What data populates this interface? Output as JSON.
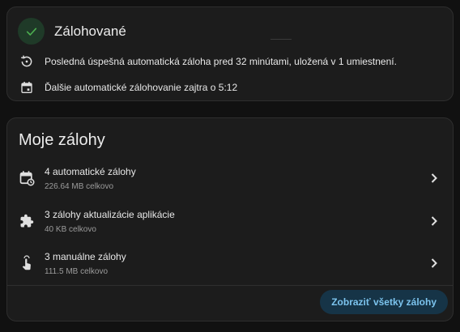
{
  "status": {
    "title": "Zálohované",
    "last_backup": "Posledná úspešná automatická záloha pred 32 minútami, uložená v 1 umiestnení.",
    "next_backup": "Ďalšie automatické zálohovanie zajtra o 5:12",
    "icons": {
      "status": "check-icon",
      "last": "history-icon",
      "next": "calendar-icon"
    },
    "colors": {
      "ok": "#4caf50",
      "ok_bg": "#1f3a28"
    }
  },
  "backups": {
    "title": "Moje zálohy",
    "items": [
      {
        "label": "4 automatické zálohy",
        "size": "226.64 MB celkovo",
        "icon": "calendar-sync-icon"
      },
      {
        "label": "3 zálohy aktualizácie aplikácie",
        "size": "40 KB celkovo",
        "icon": "puzzle-icon"
      },
      {
        "label": "3 manuálne zálohy",
        "size": "111.5 MB celkovo",
        "icon": "gesture-tap-icon"
      }
    ],
    "show_all_label": "Zobraziť všetky zálohy",
    "colors": {
      "accent": "#7cc4ee",
      "button_bg": "#163447"
    }
  }
}
